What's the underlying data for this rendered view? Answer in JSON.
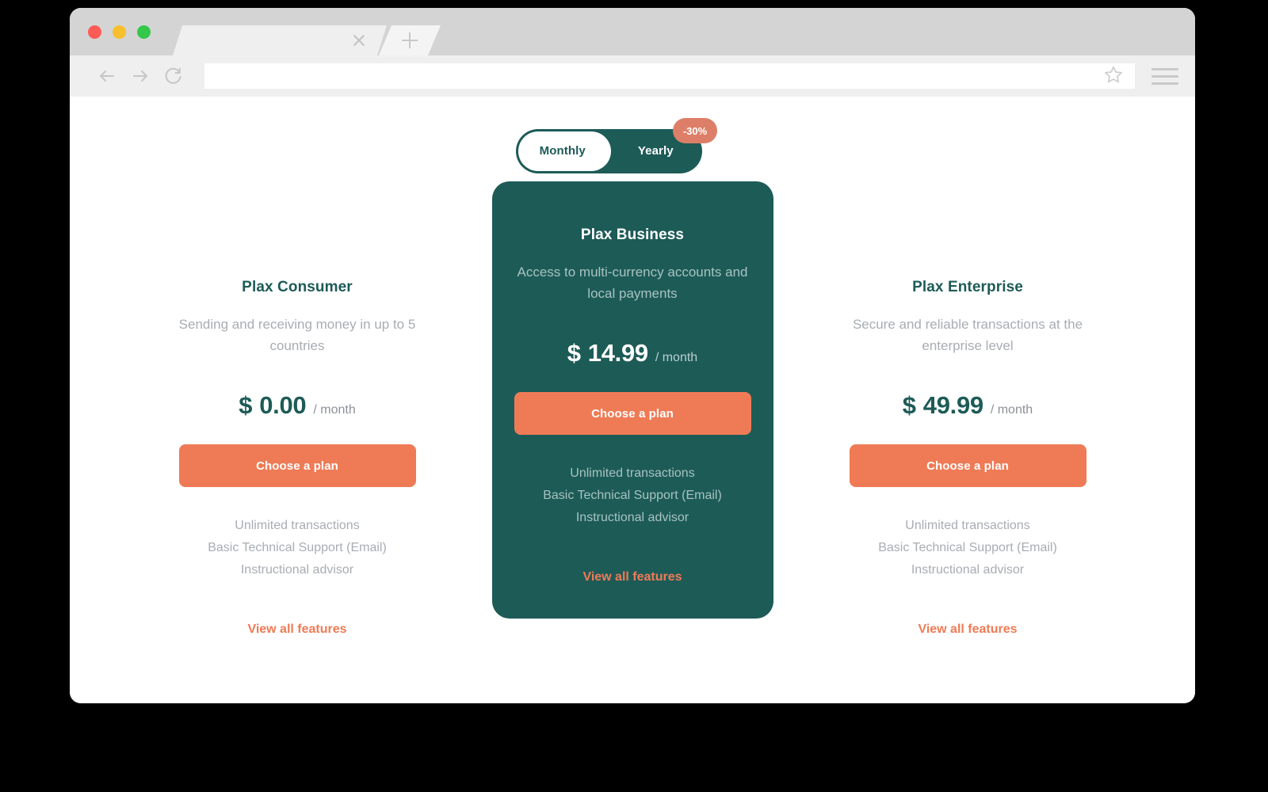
{
  "browser": {
    "traffic_lights": [
      "close",
      "minimize",
      "maximize"
    ],
    "tab": {
      "title": "",
      "close_label": "×"
    },
    "new_tab_label": "+",
    "nav": {
      "back": "back-arrow",
      "forward": "forward-arrow",
      "reload": "reload-arrow"
    },
    "address_bar": {
      "value": "",
      "placeholder": ""
    },
    "bookmark_icon": "star-icon",
    "menu_icon": "hamburger-menu-icon"
  },
  "pricing": {
    "toggle": {
      "monthly_label": "Monthly",
      "yearly_label": "Yearly",
      "active": "Monthly",
      "discount_badge": "-30%"
    },
    "plans": [
      {
        "name": "Plax Consumer",
        "description": "Sending and receiving money in up to 5 countries",
        "currency": "$",
        "price": "0.00",
        "period": "/ month",
        "cta": "Choose a plan",
        "features": [
          "Unlimited transactions",
          "Basic Technical Support (Email)",
          "Instructional advisor"
        ],
        "view_all": "View all features",
        "featured": false
      },
      {
        "name": "Plax Business",
        "description": "Access to multi-currency accounts and local payments",
        "currency": "$",
        "price": "14.99",
        "period": "/ month",
        "cta": "Choose a plan",
        "features": [
          "Unlimited transactions",
          "Basic Technical Support (Email)",
          "Instructional advisor"
        ],
        "view_all": "View all features",
        "featured": true
      },
      {
        "name": "Plax Enterprise",
        "description": "Secure and reliable transactions at the enterprise level",
        "currency": "$",
        "price": "49.99",
        "period": "/ month",
        "cta": "Choose a plan",
        "features": [
          "Unlimited transactions",
          "Basic Technical Support (Email)",
          "Instructional advisor"
        ],
        "view_all": "View all features",
        "featured": false
      }
    ]
  },
  "colors": {
    "brand_teal": "#1d5b57",
    "accent_coral": "#ef7b56",
    "badge_salmon": "#dd7f68",
    "muted_text": "#a8adb3",
    "featured_muted_text": "#a7c3c1",
    "page_background": "#ffffff",
    "outer_background": "#000000"
  }
}
